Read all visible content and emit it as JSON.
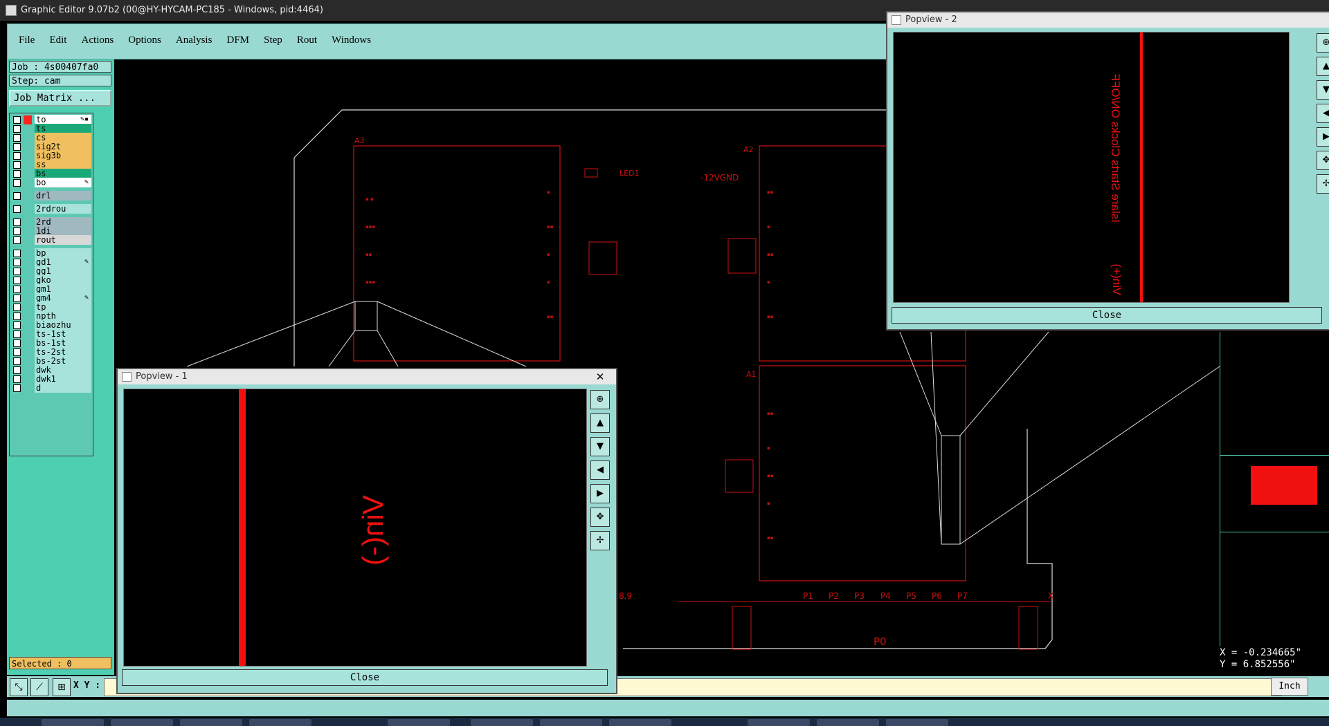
{
  "window": {
    "title": "Graphic Editor 9.07b2 (00@HY-HYCAM-PC185 - Windows, pid:4464)"
  },
  "menu": [
    "File",
    "Edit",
    "Actions",
    "Options",
    "Analysis",
    "DFM",
    "Step",
    "Rout",
    "Windows"
  ],
  "job": {
    "job_text": "Job : 4s00407fa0",
    "step_text": "Step: cam",
    "matrix_label": "Job Matrix ..."
  },
  "layers": [
    {
      "name": "to",
      "color": "#ffffff",
      "swatch": "#ff2020",
      "mark": "✎▪"
    },
    {
      "name": "ts",
      "color": "#1aaa7a",
      "swatch": "",
      "mark": ""
    },
    {
      "name": "cs",
      "color": "#f0c060",
      "swatch": "",
      "mark": ""
    },
    {
      "name": "sig2t",
      "color": "#f0c060",
      "swatch": "",
      "mark": ""
    },
    {
      "name": "sig3b",
      "color": "#f0c060",
      "swatch": "",
      "mark": ""
    },
    {
      "name": "ss",
      "color": "#f0c060",
      "swatch": "",
      "mark": ""
    },
    {
      "name": "bs",
      "color": "#1aaa7a",
      "swatch": "",
      "mark": ""
    },
    {
      "name": "bo",
      "color": "#ffffff",
      "swatch": "",
      "mark": "✎"
    },
    {
      "name": "drl",
      "color": "#a0b8c0",
      "swatch": "",
      "mark": ""
    },
    {
      "name": "2rdrou",
      "color": "#a7e3da",
      "swatch": "",
      "mark": ""
    },
    {
      "name": "2rd",
      "color": "#a0b8c0",
      "swatch": "",
      "mark": ""
    },
    {
      "name": "1di",
      "color": "#a0b8c0",
      "swatch": "",
      "mark": ""
    },
    {
      "name": "rout",
      "color": "#d8d8d8",
      "swatch": "",
      "mark": ""
    },
    {
      "name": "bp",
      "color": "#a7e3da",
      "swatch": "",
      "mark": ""
    },
    {
      "name": "gd1",
      "color": "#a7e3da",
      "swatch": "",
      "mark": "✎"
    },
    {
      "name": "gg1",
      "color": "#a7e3da",
      "swatch": "",
      "mark": ""
    },
    {
      "name": "gko",
      "color": "#a7e3da",
      "swatch": "",
      "mark": ""
    },
    {
      "name": "gm1",
      "color": "#a7e3da",
      "swatch": "",
      "mark": ""
    },
    {
      "name": "gm4",
      "color": "#a7e3da",
      "swatch": "",
      "mark": "✎"
    },
    {
      "name": "tp",
      "color": "#a7e3da",
      "swatch": "",
      "mark": ""
    },
    {
      "name": "npth",
      "color": "#a7e3da",
      "swatch": "",
      "mark": ""
    },
    {
      "name": "biaozhu",
      "color": "#a7e3da",
      "swatch": "",
      "mark": ""
    },
    {
      "name": "ts-1st",
      "color": "#a7e3da",
      "swatch": "",
      "mark": ""
    },
    {
      "name": "bs-1st",
      "color": "#a7e3da",
      "swatch": "",
      "mark": ""
    },
    {
      "name": "ts-2st",
      "color": "#a7e3da",
      "swatch": "",
      "mark": ""
    },
    {
      "name": "bs-2st",
      "color": "#a7e3da",
      "swatch": "",
      "mark": ""
    },
    {
      "name": "dwk",
      "color": "#a7e3da",
      "swatch": "",
      "mark": ""
    },
    {
      "name": "dwk1",
      "color": "#a7e3da",
      "swatch": "",
      "mark": ""
    },
    {
      "name": "d",
      "color": "#a7e3da",
      "swatch": "",
      "mark": ""
    }
  ],
  "status": {
    "selected": "Selected : 0",
    "xy_label": "X Y :",
    "unit": "Inch",
    "x_readout": "X = -0.234665\"",
    "y_readout": "Y = 6.852556\""
  },
  "board": {
    "labels": [
      "A3",
      "A2",
      "A1",
      "-12VGND",
      "LED1",
      "P1",
      "P2",
      "P3",
      "P4",
      "P5",
      "P6",
      "P7",
      "P0",
      "8.9",
      "X"
    ]
  },
  "popview1": {
    "title": "Popview - 1",
    "close_label": "Close",
    "text": "Vin(-)"
  },
  "popview2": {
    "title": "Popview - 2",
    "close_label": "Close",
    "text1": "Islare Starts Clocks ON/OFF",
    "text2": "Vin(+)"
  },
  "colors": {
    "teal_panel": "#4fcfb1",
    "menu_bg": "#9ad9d2",
    "trace_red": "#e01010",
    "outline_white": "#ffffff"
  }
}
